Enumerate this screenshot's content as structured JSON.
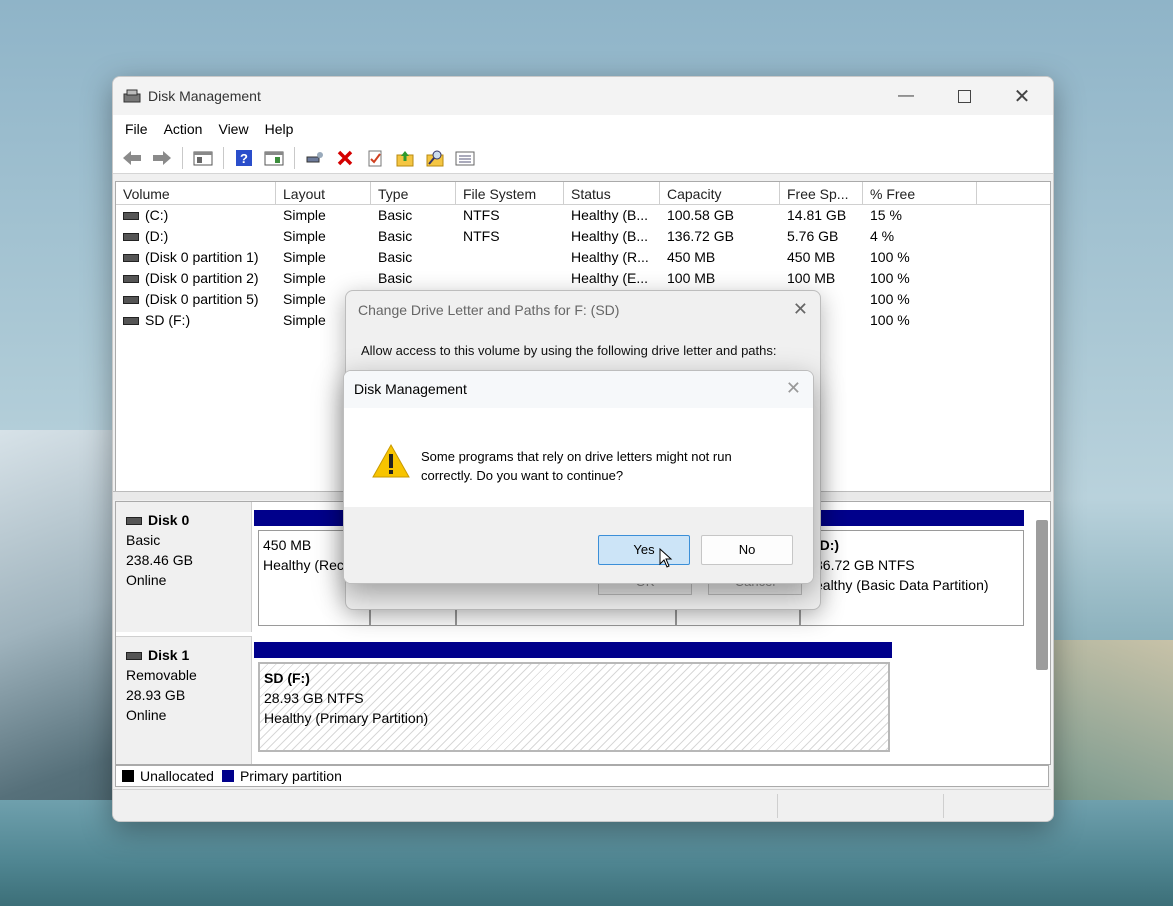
{
  "window": {
    "title": "Disk Management"
  },
  "menu": [
    "File",
    "Action",
    "View",
    "Help"
  ],
  "volume_list": {
    "columns": [
      "Volume",
      "Layout",
      "Type",
      "File System",
      "Status",
      "Capacity",
      "Free Sp...",
      "% Free"
    ],
    "rows": [
      [
        "(C:)",
        "Simple",
        "Basic",
        "NTFS",
        "Healthy (B...",
        "100.58 GB",
        "14.81 GB",
        "15 %"
      ],
      [
        "(D:)",
        "Simple",
        "Basic",
        "NTFS",
        "Healthy (B...",
        "136.72 GB",
        "5.76 GB",
        "4 %"
      ],
      [
        "(Disk 0 partition 1)",
        "Simple",
        "Basic",
        "",
        "Healthy (R...",
        "450 MB",
        "450 MB",
        "100 %"
      ],
      [
        "(Disk 0 partition 2)",
        "Simple",
        "Basic",
        "",
        "Healthy (E...",
        "100 MB",
        "100 MB",
        "100 %"
      ],
      [
        "(Disk 0 partition 5)",
        "Simple",
        "",
        "",
        "",
        "",
        "MB",
        "100 %"
      ],
      [
        "SD (F:)",
        "Simple",
        "",
        "",
        "",
        "",
        "5 GB",
        "100 %"
      ]
    ]
  },
  "disks": {
    "disk0": {
      "name": "Disk 0",
      "type": "Basic",
      "size": "238.46 GB",
      "state": "Online",
      "part1": {
        "size": "450 MB",
        "status": "Healthy (Rec"
      },
      "partD": {
        "name": "(D:)",
        "size": "36.72 GB NTFS",
        "status": "ealthy (Basic Data Partition)"
      }
    },
    "disk1": {
      "name": "Disk 1",
      "type": "Removable",
      "size": "28.93 GB",
      "state": "Online",
      "partF": {
        "name": "SD  (F:)",
        "size": "28.93 GB NTFS",
        "status": "Healthy (Primary Partition)"
      }
    }
  },
  "legend": {
    "unallocated": "Unallocated",
    "primary": "Primary partition"
  },
  "back_dialog": {
    "title": "Change Drive Letter and Paths for F: (SD)",
    "prompt": "Allow access to this volume by using the following drive letter and paths:",
    "ok": "OK",
    "cancel": "Cancel"
  },
  "confirm_dialog": {
    "title": "Disk Management",
    "message_line1": "Some programs that rely on drive letters might not run",
    "message_line2": "correctly. Do you want to continue?",
    "yes": "Yes",
    "no": "No"
  },
  "colors": {
    "primary_partition": "#00008b",
    "accent": "#3b8fd8",
    "error_red": "#d40000"
  }
}
